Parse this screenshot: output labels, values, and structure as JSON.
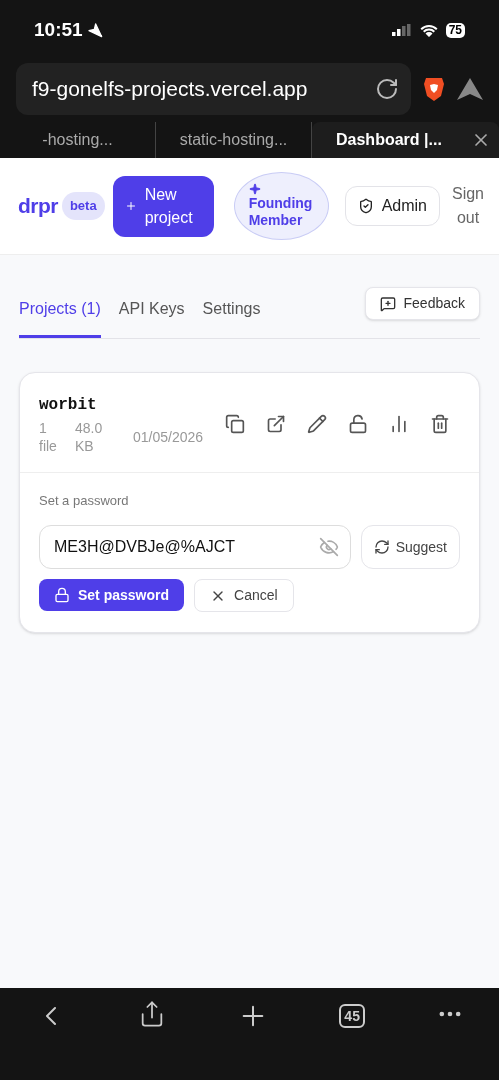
{
  "status_bar": {
    "time": "10:51",
    "battery": "75"
  },
  "address_bar": {
    "url": "f9-gonelfs-projects.vercel.app"
  },
  "browser_tabs": [
    {
      "title": "-hosting...",
      "selected": false
    },
    {
      "title": "static-hosting...",
      "selected": false
    },
    {
      "title": "Dashboard |...",
      "selected": true
    }
  ],
  "header": {
    "logo": "drpr",
    "badge": "beta",
    "new_project": "New project",
    "founding": "Founding Member",
    "admin": "Admin",
    "sign_out": "Sign out"
  },
  "tabs": [
    {
      "label": "Projects (1)",
      "selected": true
    },
    {
      "label": "API Keys",
      "selected": false
    },
    {
      "label": "Settings",
      "selected": false
    }
  ],
  "feedback": "Feedback",
  "project": {
    "name": "worbit",
    "files": "1 file",
    "size": "48.0 KB",
    "date": "01/05/2026",
    "password": {
      "label": "Set a password",
      "value": "ME3H@DVBJe@%AJCT",
      "suggest": "Suggest",
      "submit": "Set password",
      "cancel": "Cancel"
    }
  },
  "toolbar": {
    "tab_count": "45"
  }
}
